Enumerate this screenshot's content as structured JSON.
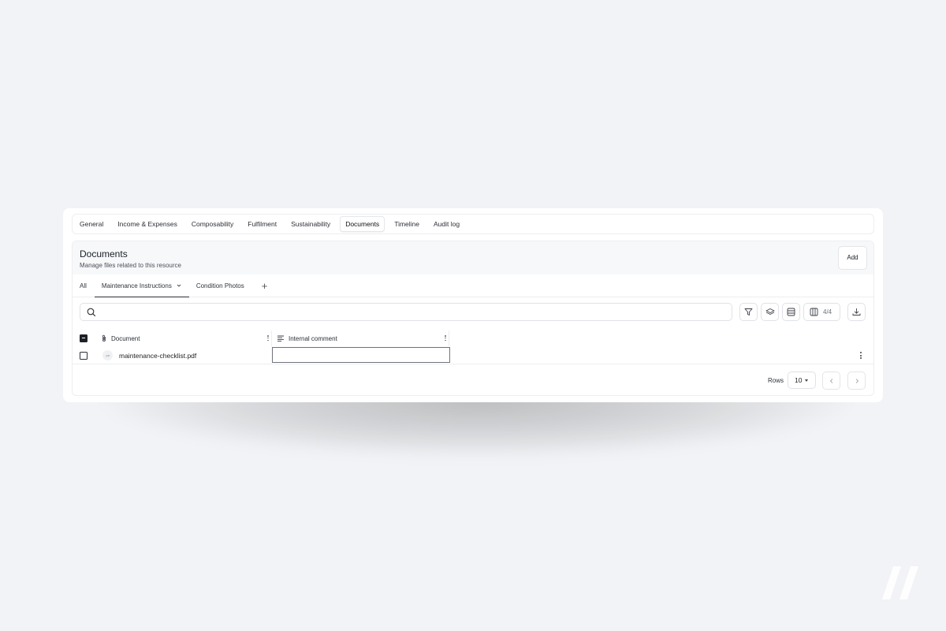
{
  "tabs": [
    {
      "label": "General",
      "active": false
    },
    {
      "label": "Income & Expenses",
      "active": false
    },
    {
      "label": "Composability",
      "active": false
    },
    {
      "label": "Fulfilment",
      "active": false
    },
    {
      "label": "Sustainability",
      "active": false
    },
    {
      "label": "Documents",
      "active": true
    },
    {
      "label": "Timeline",
      "active": false
    },
    {
      "label": "Audit log",
      "active": false
    }
  ],
  "panel": {
    "title": "Documents",
    "subtitle": "Manage files related to this resource",
    "add_label": "Add"
  },
  "subtabs": {
    "all": "All",
    "maintenance": "Maintenance Instructions",
    "condition": "Condition Photos",
    "add": "+"
  },
  "search": {
    "value": "",
    "placeholder": ""
  },
  "toolbar": {
    "columns_count": "4/4"
  },
  "table": {
    "columns": [
      "Document",
      "Internal comment"
    ],
    "rows": [
      {
        "file_type": "pdf",
        "document": "maintenance-checklist.pdf",
        "comment": ""
      }
    ]
  },
  "pagination": {
    "rows_label": "Rows",
    "rows_value": "10"
  },
  "icons": [
    "search-icon",
    "filter-icon",
    "layers-icon",
    "rows-icon",
    "columns-icon",
    "download-icon",
    "paperclip-icon",
    "text-lines-icon",
    "chevron-down-icon",
    "chevron-left-icon",
    "chevron-right-icon",
    "kebab-icon",
    "brand-logo"
  ]
}
